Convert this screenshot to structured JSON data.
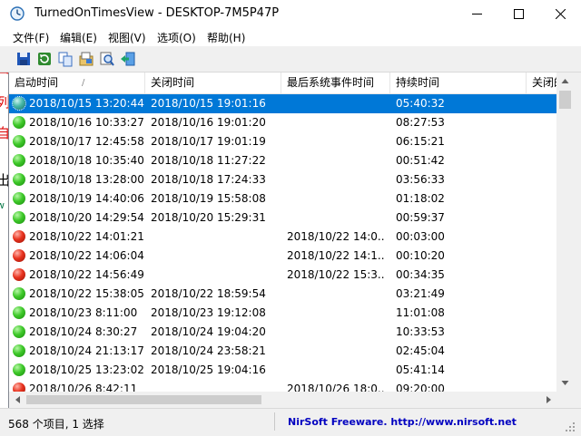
{
  "window": {
    "title": "TurnedOnTimesView  -  DESKTOP-7M5P47P"
  },
  "menu": [
    "文件(F)",
    "编辑(E)",
    "视图(V)",
    "选项(O)",
    "帮助(H)"
  ],
  "toolbar_icons": [
    "save-icon",
    "refresh-icon",
    "copy-icon",
    "properties-icon",
    "find-icon",
    "exit-icon"
  ],
  "columns": [
    "启动时间",
    "关闭时间",
    "最后系统事件时间",
    "持续时间",
    "关闭的"
  ],
  "sort_indicator": "/",
  "rows": [
    {
      "status": "teal",
      "start": "2018/10/15 13:20:44",
      "end": "2018/10/15 19:01:16",
      "last": "",
      "duration": "05:40:32",
      "selected": true
    },
    {
      "status": "green",
      "start": "2018/10/16 10:33:27",
      "end": "2018/10/16 19:01:20",
      "last": "",
      "duration": "08:27:53"
    },
    {
      "status": "green",
      "start": "2018/10/17 12:45:58",
      "end": "2018/10/17 19:01:19",
      "last": "",
      "duration": "06:15:21"
    },
    {
      "status": "green",
      "start": "2018/10/18 10:35:40",
      "end": "2018/10/18 11:27:22",
      "last": "",
      "duration": "00:51:42"
    },
    {
      "status": "green",
      "start": "2018/10/18 13:28:00",
      "end": "2018/10/18 17:24:33",
      "last": "",
      "duration": "03:56:33"
    },
    {
      "status": "green",
      "start": "2018/10/19 14:40:06",
      "end": "2018/10/19 15:58:08",
      "last": "",
      "duration": "01:18:02"
    },
    {
      "status": "green",
      "start": "2018/10/20 14:29:54",
      "end": "2018/10/20 15:29:31",
      "last": "",
      "duration": "00:59:37"
    },
    {
      "status": "red",
      "start": "2018/10/22 14:01:21",
      "end": "",
      "last": "2018/10/22 14:0...",
      "duration": "00:03:00"
    },
    {
      "status": "red",
      "start": "2018/10/22 14:06:04",
      "end": "",
      "last": "2018/10/22 14:1...",
      "duration": "00:10:20"
    },
    {
      "status": "red",
      "start": "2018/10/22 14:56:49",
      "end": "",
      "last": "2018/10/22 15:3...",
      "duration": "00:34:35"
    },
    {
      "status": "green",
      "start": "2018/10/22 15:38:05",
      "end": "2018/10/22 18:59:54",
      "last": "",
      "duration": "03:21:49"
    },
    {
      "status": "green",
      "start": "2018/10/23 8:11:00",
      "end": "2018/10/23 19:12:08",
      "last": "",
      "duration": "11:01:08"
    },
    {
      "status": "green",
      "start": "2018/10/24 8:30:27",
      "end": "2018/10/24 19:04:20",
      "last": "",
      "duration": "10:33:53"
    },
    {
      "status": "green",
      "start": "2018/10/24 21:13:17",
      "end": "2018/10/24 23:58:21",
      "last": "",
      "duration": "02:45:04"
    },
    {
      "status": "green",
      "start": "2018/10/25 13:23:02",
      "end": "2018/10/25 19:04:16",
      "last": "",
      "duration": "05:41:14"
    },
    {
      "status": "red",
      "start": "2018/10/26 8:42:11",
      "end": "",
      "last": "2018/10/26 18:0...",
      "duration": "09:20:00"
    }
  ],
  "status": {
    "count": "568 个项目, 1 选择",
    "link": "NirSoft Freeware.  http://www.nirsoft.net"
  },
  "edge_glyphs": [
    "?",
    "自",
    "列",
    "自",
    "出",
    "w"
  ]
}
